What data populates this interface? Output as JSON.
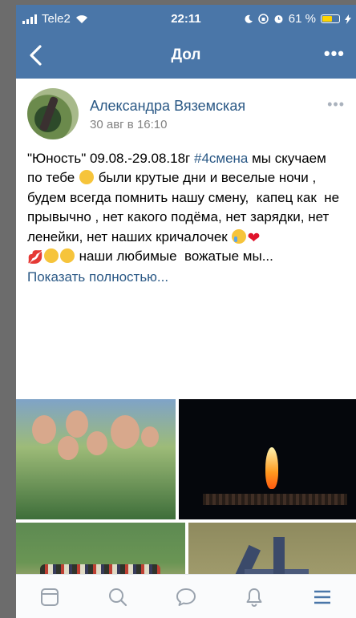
{
  "status_bar": {
    "carrier": "Tele2",
    "time": "22:11",
    "battery_percent": "61 %",
    "battery_level": 0.61
  },
  "nav": {
    "title": "Дол"
  },
  "post": {
    "author": "Александра Вяземская",
    "date": "30 авг в 16:10",
    "text_part1": "\"Юность\" 09.08.-29.08.18г ",
    "hashtag": "#4смена",
    "text_part2": " мы скучаем по тебе ",
    "text_part3": " были крутые дни и веселые ночи , будем всегда помнить нашу смену,  капец как  не прывычно , нет какого подёма, нет зарядки, нет ленейки, нет наших кричалочек ",
    "text_part4": " наши любимые  вожатые мы...",
    "show_more": "Показать полностью..."
  },
  "tabbar": {
    "items": [
      "news-icon",
      "search-icon",
      "messages-icon",
      "notifications-icon",
      "menu-icon"
    ],
    "active_color": "#4a76a8",
    "inactive_color": "#99a2ad"
  },
  "colors": {
    "header": "#4a76a8",
    "link": "#2a5885"
  }
}
